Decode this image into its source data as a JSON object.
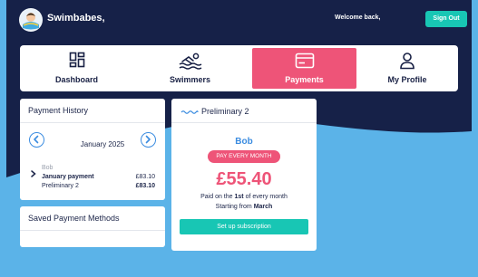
{
  "header": {
    "brand": "Swimbabes,",
    "welcome": "Welcome back,",
    "signout_label": "Sign Out"
  },
  "nav": {
    "items": [
      {
        "label": "Dashboard",
        "icon": "dashboard-icon"
      },
      {
        "label": "Swimmers",
        "icon": "swimmer-icon"
      },
      {
        "label": "Payments",
        "icon": "credit-card-icon",
        "active": true
      },
      {
        "label": "My Profile",
        "icon": "user-icon"
      }
    ]
  },
  "history": {
    "title": "Payment History",
    "month": "January 2025",
    "entry": {
      "name": "Bob",
      "line1_label": "January payment",
      "line1_amount": "£83.10",
      "line2_label": "Preliminary 2",
      "line2_amount": "£83.10"
    }
  },
  "saved_methods": {
    "title": "Saved Payment Methods"
  },
  "plan": {
    "title": "Preliminary 2",
    "swimmer": "Bob",
    "badge": "PAY EVERY MONTH",
    "price": "£55.40",
    "paid_prefix": "Paid on the ",
    "paid_day": "1st",
    "paid_suffix": " of every month",
    "start_prefix": "Starting from ",
    "start_month": "March",
    "button_label": "Set up subscription"
  },
  "colors": {
    "navy": "#162148",
    "sky": "#5bb3e8",
    "teal": "#18c6b4",
    "pink": "#ee5478"
  }
}
